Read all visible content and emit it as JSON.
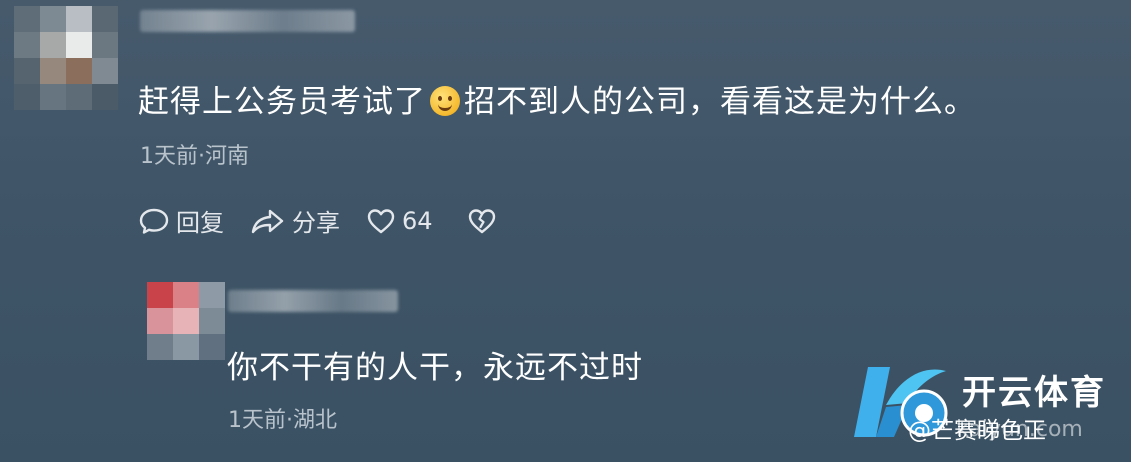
{
  "comment": {
    "text_part1": "赶得上公务员考试了",
    "emoji": "smiley-emoji",
    "text_part2": "招不到人的公司，看看这是为什么。",
    "meta": "1天前·河南",
    "actions": {
      "reply_label": "回复",
      "share_label": "分享",
      "like_count": "64"
    }
  },
  "reply": {
    "text": "你不干有的人干，永远不过时",
    "meta": "1天前·湖北"
  },
  "watermark": {
    "brand": "开云体育",
    "sub": "@芒赛睇色正",
    "url": "kaiyun.com"
  },
  "icons": {
    "reply": "chat-bubble-icon",
    "share": "share-arrow-icon",
    "like": "heart-icon",
    "dislike": "broken-heart-icon"
  }
}
